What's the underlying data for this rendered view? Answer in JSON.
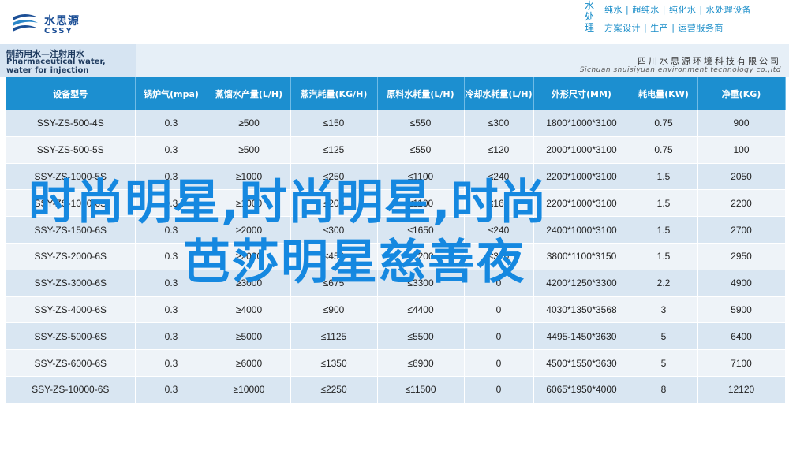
{
  "header": {
    "logo_cn": "水思源",
    "logo_en": "CSSY",
    "process_side": "水处理",
    "process_line1": "纯水 | 超纯水 | 纯化水 | 水处理设备",
    "process_line2": "方案设计 | 生产 | 运营服务商"
  },
  "band": {
    "title_cn": "制药用水—注射用水",
    "title_en": "Pharmaceutical water, water for injection",
    "company_cn": "四川水思源环境科技有限公司",
    "company_en": "Sichuan shuisiyuan environment technology co.,ltd"
  },
  "table": {
    "columns": [
      "设备型号",
      "锅炉气(mpa)",
      "蒸馏水产量(L/H)",
      "蒸汽耗量(KG/H)",
      "原料水耗量(L/H)",
      "冷却水耗量(L/H)",
      "外形尺寸(MM)",
      "耗电量(KW)",
      "净重(KG)"
    ],
    "rows": [
      [
        "SSY-ZS-500-4S",
        "0.3",
        "≥500",
        "≤150",
        "≤550",
        "≤300",
        "1800*1000*3100",
        "0.75",
        "900"
      ],
      [
        "SSY-ZS-500-5S",
        "0.3",
        "≥500",
        "≤125",
        "≤550",
        "≤120",
        "2000*1000*3100",
        "0.75",
        "100"
      ],
      [
        "SSY-ZS-1000-5S",
        "0.3",
        "≥1000",
        "≤250",
        "≤1100",
        "≤240",
        "2200*1000*3100",
        "1.5",
        "2050"
      ],
      [
        "SSY-ZS-1000-6S",
        "0.3",
        "≥1000",
        "≤200",
        "≤1100",
        "≤160",
        "2200*1000*3100",
        "1.5",
        "2200"
      ],
      [
        "SSY-ZS-1500-6S",
        "0.3",
        "≥2000",
        "≤300",
        "≤1650",
        "≤240",
        "2400*1000*3100",
        "1.5",
        "2700"
      ],
      [
        "SSY-ZS-2000-6S",
        "0.3",
        "≥2000",
        "≤450",
        "≤2200",
        "≤320",
        "3800*1100*3150",
        "1.5",
        "2950"
      ],
      [
        "SSY-ZS-3000-6S",
        "0.3",
        "≥3000",
        "≤675",
        "≤3300",
        "0",
        "4200*1250*3300",
        "2.2",
        "4900"
      ],
      [
        "SSY-ZS-4000-6S",
        "0.3",
        "≥4000",
        "≤900",
        "≤4400",
        "0",
        "4030*1350*3568",
        "3",
        "5900"
      ],
      [
        "SSY-ZS-5000-6S",
        "0.3",
        "≥5000",
        "≤1125",
        "≤5500",
        "0",
        "4495-1450*3630",
        "5",
        "6400"
      ],
      [
        "SSY-ZS-6000-6S",
        "0.3",
        "≥6000",
        "≤1350",
        "≤6900",
        "0",
        "4500*1550*3630",
        "5",
        "7100"
      ],
      [
        "SSY-ZS-10000-6S",
        "0.3",
        "≥10000",
        "≤2250",
        "≤11500",
        "0",
        "6065*1950*4000",
        "8",
        "12120"
      ]
    ]
  },
  "overlay": {
    "line1": "时尚明星,时尚明星,时尚",
    "line2": "芭莎明星慈善夜"
  },
  "colors": {
    "header_blue": "#1c8fd0",
    "overlay_blue": "#1588e0",
    "row_odd": "#d9e6f2",
    "row_even": "#eef3f8"
  }
}
